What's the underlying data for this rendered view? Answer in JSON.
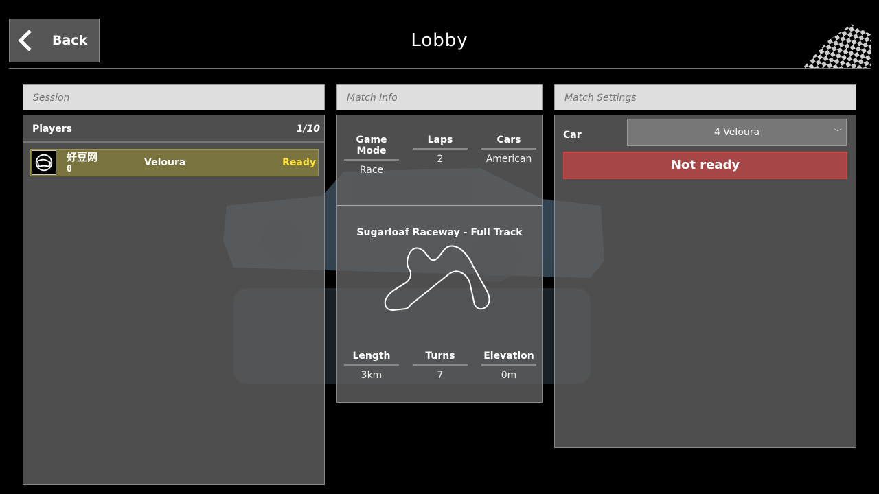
{
  "header": {
    "back_label": "Back",
    "title": "Lobby"
  },
  "session": {
    "title": "Session",
    "players_label": "Players",
    "players_count": "1/10",
    "players": [
      {
        "name": "好豆网",
        "score": "0",
        "car": "Veloura",
        "status": "Ready",
        "status_color": "#ffe23a"
      }
    ]
  },
  "match_info": {
    "title": "Match Info",
    "game_mode_label": "Game Mode",
    "game_mode": "Race",
    "laps_label": "Laps",
    "laps": "2",
    "cars_label": "Cars",
    "cars": "American",
    "track_name": "Sugarloaf Raceway - Full Track",
    "length_label": "Length",
    "length": "3km",
    "turns_label": "Turns",
    "turns": "7",
    "elevation_label": "Elevation",
    "elevation": "0m"
  },
  "match_settings": {
    "title": "Match Settings",
    "car_label": "Car",
    "car_value": "4 Veloura",
    "ready_button": "Not ready",
    "ready_button_color": "#a64646"
  },
  "icons": {
    "back": "chevron-left-icon",
    "flag": "checkered-flag-icon",
    "avatar": "helmet-icon",
    "dropdown": "chevron-down-icon"
  }
}
